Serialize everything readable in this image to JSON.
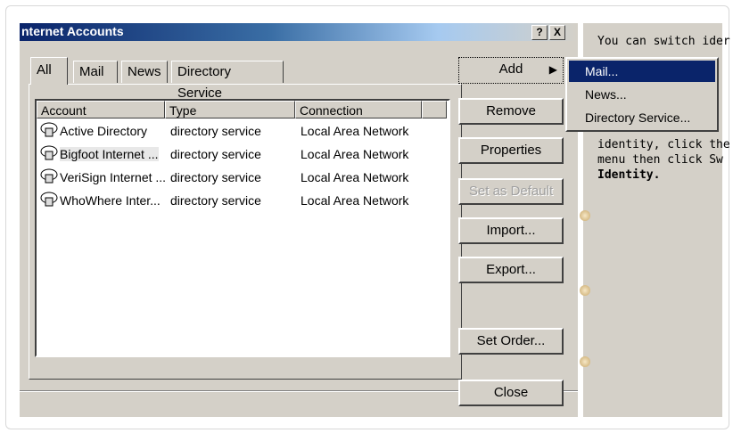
{
  "window": {
    "title": "nternet Accounts",
    "help_button": "?",
    "close_button": "X"
  },
  "tabs": [
    "All",
    "Mail",
    "News",
    "Directory Service"
  ],
  "accounts_table": {
    "columns": [
      "Account",
      "Type",
      "Connection"
    ],
    "rows": [
      {
        "account": "Active Directory",
        "type": "directory service",
        "connection": "Local Area Network"
      },
      {
        "account": "Bigfoot Internet ...",
        "type": "directory service",
        "connection": "Local Area Network"
      },
      {
        "account": "VeriSign Internet ...",
        "type": "directory service",
        "connection": "Local Area Network"
      },
      {
        "account": "WhoWhere Inter...",
        "type": "directory service",
        "connection": "Local Area Network"
      }
    ]
  },
  "buttons": {
    "add": "Add",
    "remove": "Remove",
    "properties": "Properties",
    "set_default": "Set as Default",
    "import": "Import...",
    "export": "Export...",
    "set_order": "Set Order...",
    "close": "Close"
  },
  "add_menu": {
    "items": [
      "Mail...",
      "News...",
      "Directory Service..."
    ],
    "highlighted": "Mail..."
  },
  "side_text": {
    "line1": "You can switch ider",
    "line2": "identity, click the F",
    "line3": "menu then click Sw",
    "line4": "Identity."
  },
  "colors": {
    "titlebar": "#0a246a",
    "menu_highlight": "#0a246a",
    "dialog_bg": "#d4d0c8"
  }
}
